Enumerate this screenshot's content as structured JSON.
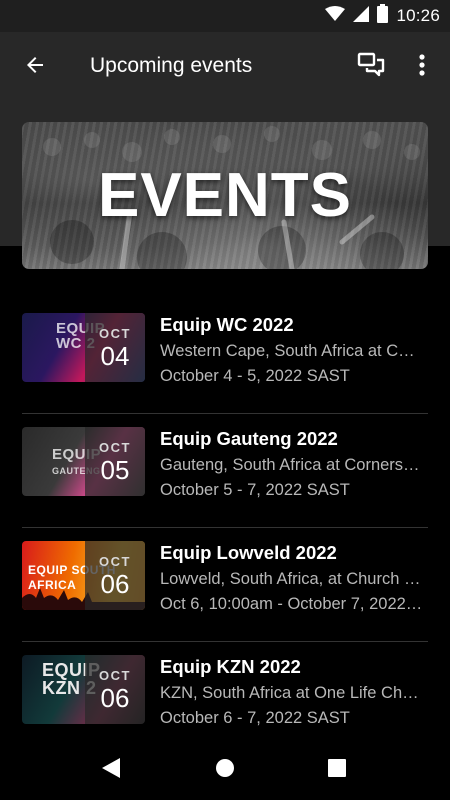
{
  "status_bar": {
    "time": "10:26",
    "icons": [
      "wifi-icon",
      "cell-signal-icon",
      "battery-icon"
    ]
  },
  "app_bar": {
    "title": "Upcoming events",
    "back_icon": "arrow-back-icon",
    "chat_icon": "chat-bubbles-icon",
    "more_icon": "more-vert-icon"
  },
  "banner": {
    "text": "EVENTS"
  },
  "events": [
    {
      "title": "Equip WC 2022",
      "location": "Western Cape, South Africa at C…",
      "date": "October 4 - 5, 2022 SAST",
      "month": "OCT",
      "day": "04",
      "thumb_text": "EQUIP\nWC 2\n4-5 OCT"
    },
    {
      "title": "Equip Gauteng 2022",
      "location": "Gauteng, South Africa at Corners…",
      "date": "October 5 - 7, 2022 SAST",
      "month": "OCT",
      "day": "05",
      "thumb_text": "EQUIP\nGAUTENG"
    },
    {
      "title": "Equip Lowveld 2022",
      "location": "Lowveld, South Africa, at Church …",
      "date": "Oct 6, 10:00am - October 7, 2022…",
      "month": "OCT",
      "day": "06",
      "thumb_text": "EQUIP SOUTH AFRICA\nLOWVELD"
    },
    {
      "title": "Equip KZN 2022",
      "location": "KZN, South Africa at One Life Ch…",
      "date": "October 6 - 7, 2022 SAST",
      "month": "OCT",
      "day": "06",
      "thumb_text": "EQUIP\nKZN 2\n6-7 OCT"
    }
  ],
  "nav_bar": {
    "icons": [
      "nav-back-icon",
      "nav-home-icon",
      "nav-recents-icon"
    ]
  },
  "colors": {
    "background": "#000000",
    "app_bar": "#282828",
    "status_bar": "#1f1f1f",
    "secondary_text": "#b8b8b8"
  }
}
